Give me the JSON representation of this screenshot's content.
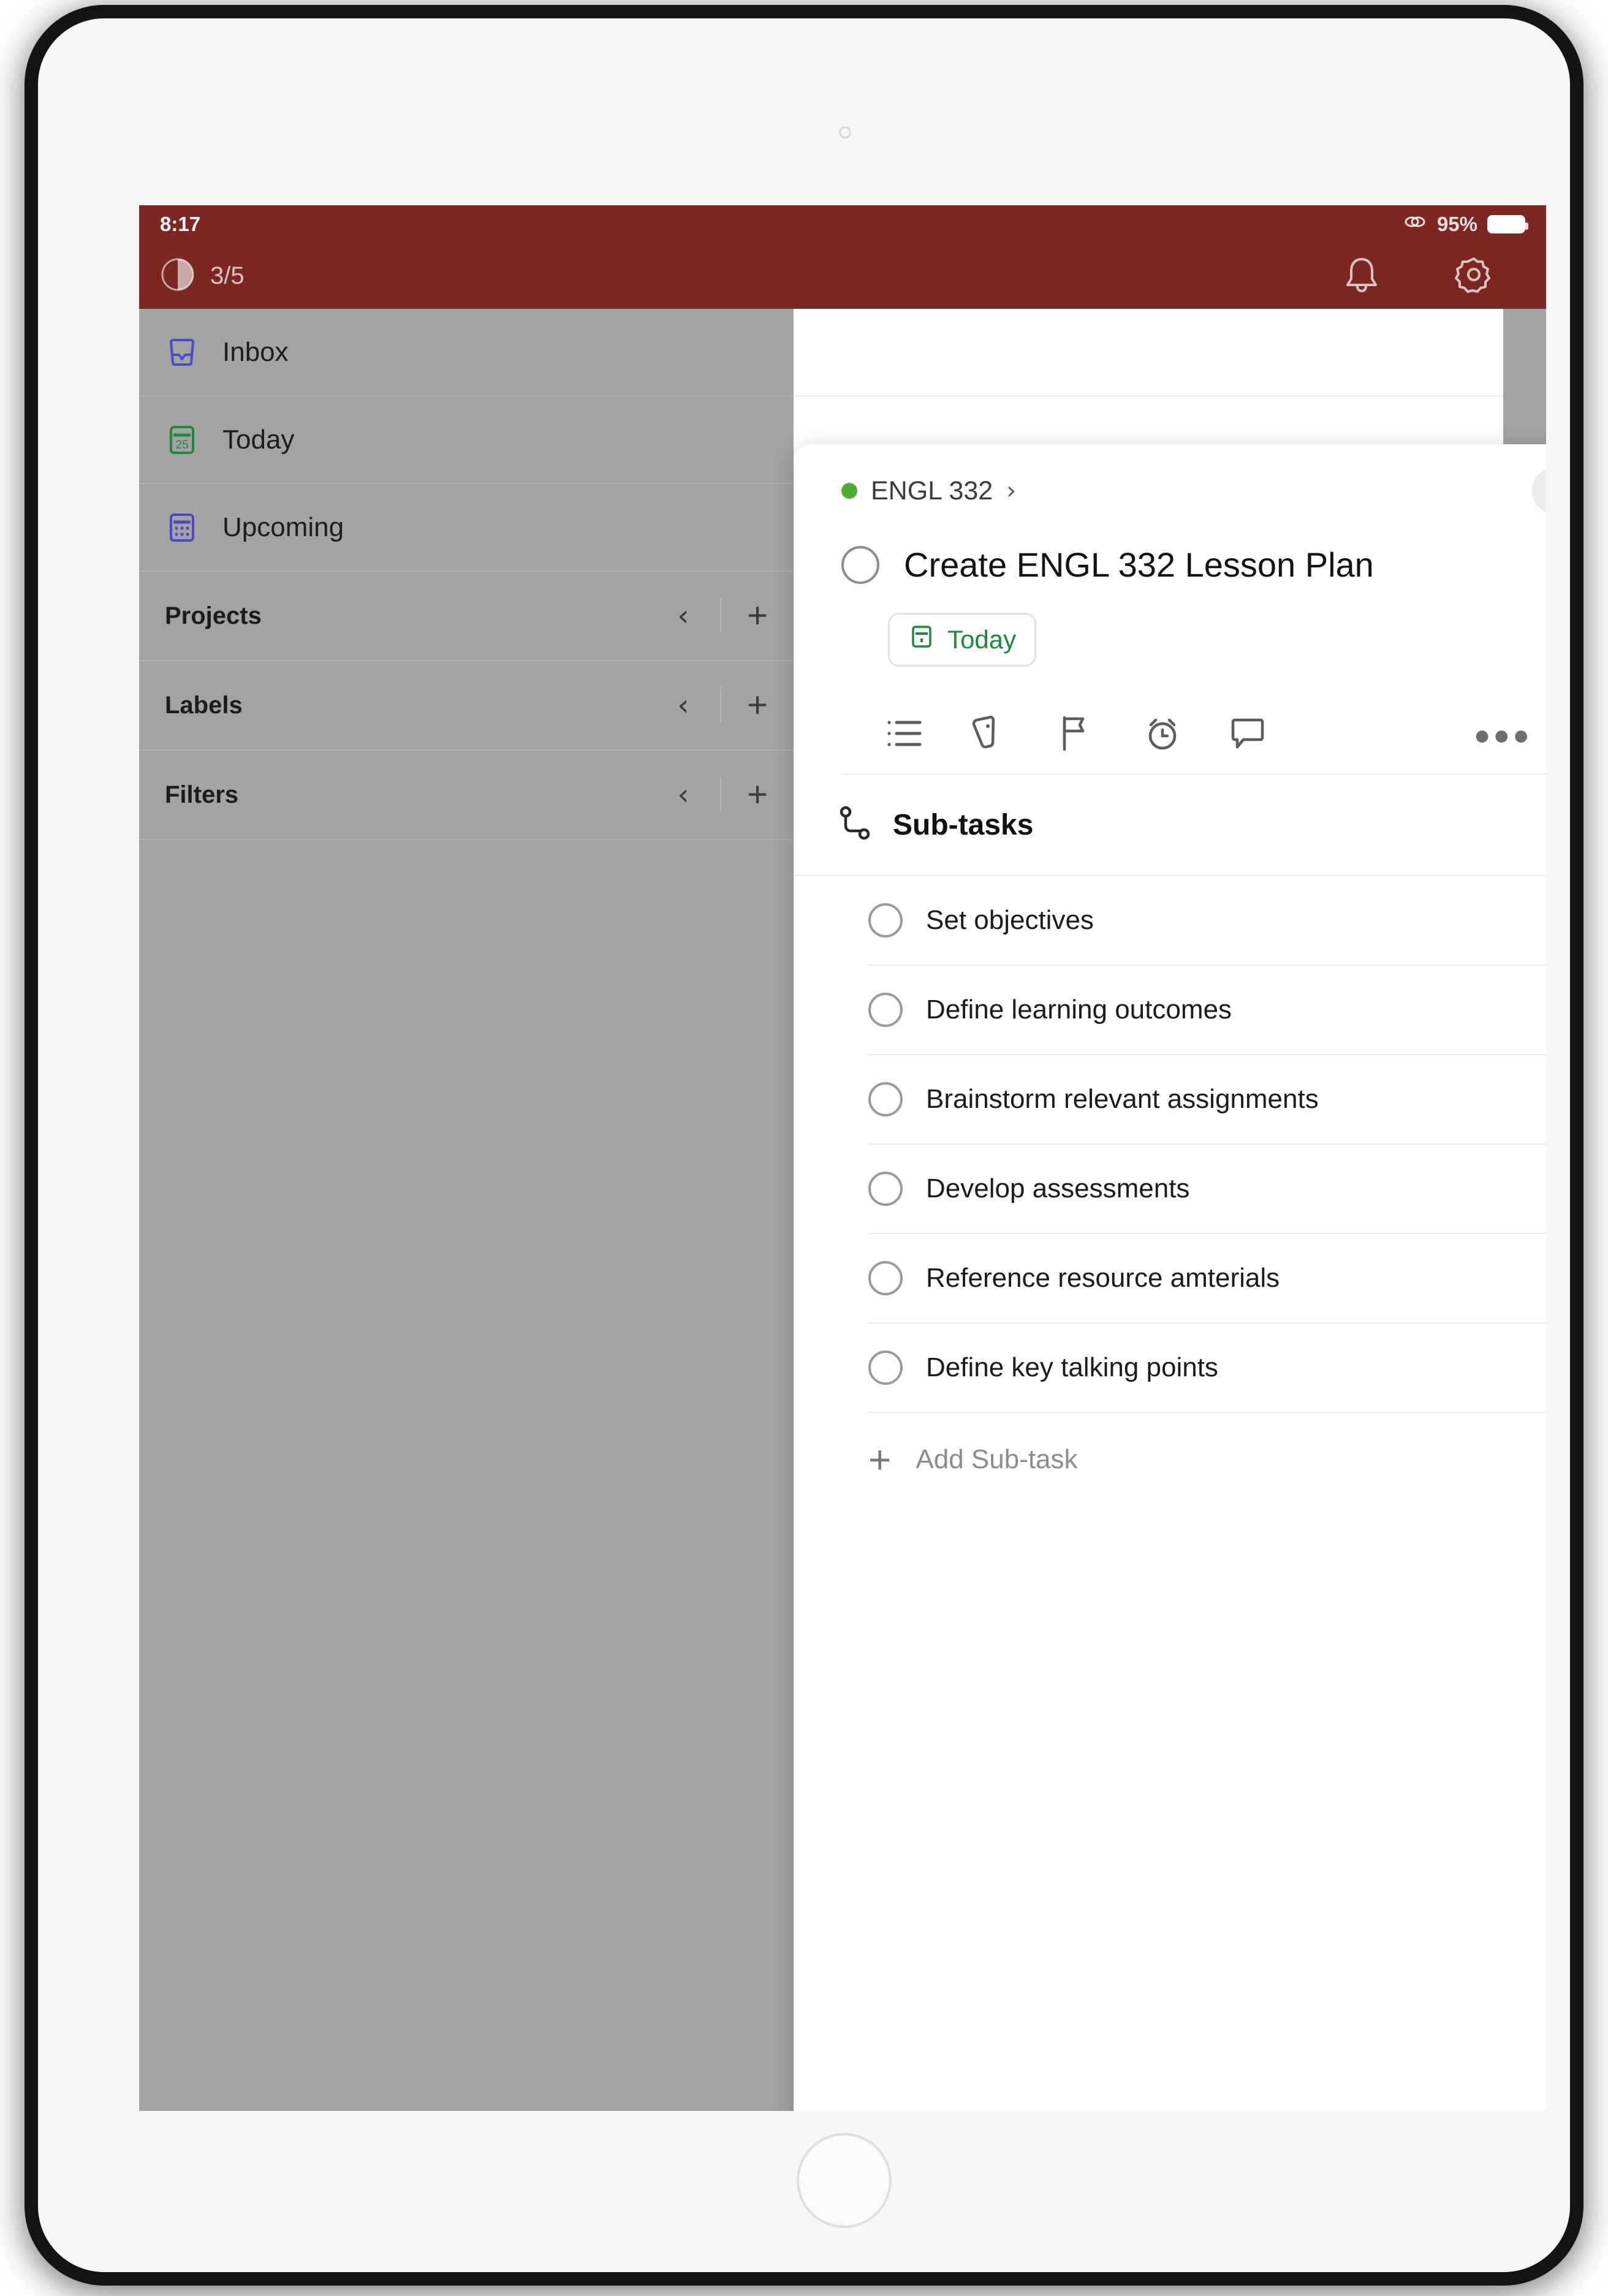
{
  "status_bar": {
    "time": "8:17",
    "battery_percent": "95%",
    "link_icon": "link-icon",
    "battery_icon": "battery-icon"
  },
  "app_bar": {
    "progress_icon": "progress-circle-icon",
    "progress_label": "3/5",
    "notifications_icon": "bell-icon",
    "settings_icon": "gear-icon"
  },
  "sidebar": {
    "nav_items": [
      {
        "label": "Inbox",
        "icon": "inbox-icon",
        "color": "#5a5acb"
      },
      {
        "label": "Today",
        "icon": "calendar-25-icon",
        "color": "#1f8a3b"
      },
      {
        "label": "Upcoming",
        "icon": "upcoming-calendar-icon",
        "color": "#5a5acb"
      }
    ],
    "sections": [
      {
        "title": "Projects",
        "collapse_icon": "chevron-left-icon",
        "add_icon": "plus-icon"
      },
      {
        "title": "Labels",
        "collapse_icon": "chevron-left-icon",
        "add_icon": "plus-icon"
      },
      {
        "title": "Filters",
        "collapse_icon": "chevron-left-icon",
        "add_icon": "plus-icon"
      }
    ]
  },
  "modal": {
    "breadcrumb": {
      "project_dot_color": "#4caf2f",
      "project_name": "ENGL 332",
      "chevron": "›",
      "close_label": "✕",
      "close_icon": "close-icon"
    },
    "task": {
      "title": "Create ENGL 332 Lesson Plan",
      "checkbox_icon": "task-checkbox-icon",
      "date_chip": {
        "icon": "calendar-icon",
        "label": "Today",
        "color": "#21873c"
      }
    },
    "toolbar": [
      {
        "icon": "subtask-list-icon"
      },
      {
        "icon": "label-tag-icon"
      },
      {
        "icon": "priority-flag-icon"
      },
      {
        "icon": "reminder-alarm-icon"
      },
      {
        "icon": "comment-icon"
      }
    ],
    "more_label": "●●●",
    "more_icon": "more-options-icon",
    "subtasks": {
      "header_icon": "subtasks-branch-icon",
      "header_label": "Sub-tasks",
      "items": [
        {
          "label": "Set objectives",
          "done": false
        },
        {
          "label": "Define learning outcomes",
          "done": false
        },
        {
          "label": "Brainstorm relevant assignments",
          "done": false
        },
        {
          "label": "Develop assessments",
          "done": false
        },
        {
          "label": "Reference resource amterials",
          "done": false
        },
        {
          "label": "Define key talking points",
          "done": false
        }
      ],
      "add_label": "Add Sub-task",
      "add_icon": "plus-icon"
    }
  },
  "theme": {
    "accent_maroon": "#7c2722",
    "sidebar_grey": "#a3a3a3",
    "green": "#21873c"
  }
}
